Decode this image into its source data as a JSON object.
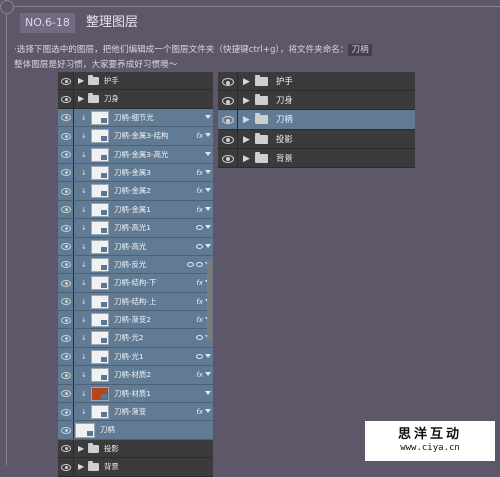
{
  "header": {
    "badge": "NO.6-18",
    "title": "整理图层",
    "instruction_line1_a": "·选择下图选中的图层，把他们编辑成一个图层文件夹（快捷键ctrl+g），将文件夹命名：",
    "instruction_line1_b": "刀柄",
    "instruction_line2": "整体图层是好习惯，大家要养成好习惯噢～"
  },
  "left_panel": {
    "rows": [
      {
        "label": "护手",
        "type": "group",
        "selected": false
      },
      {
        "label": "刀身",
        "type": "group",
        "selected": false
      },
      {
        "label": "刀柄-细节光",
        "type": "layer",
        "selected": true,
        "fx": ""
      },
      {
        "label": "刀柄-金属3-结构",
        "type": "layer",
        "selected": true,
        "fx": "fx"
      },
      {
        "label": "刀柄-金属3-高光",
        "type": "layer",
        "selected": true,
        "fx": ""
      },
      {
        "label": "刀柄-金属3",
        "type": "layer",
        "selected": true,
        "fx": "fx"
      },
      {
        "label": "刀柄-金属2",
        "type": "layer",
        "selected": true,
        "fx": "fx"
      },
      {
        "label": "刀柄-金属1",
        "type": "layer",
        "selected": true,
        "fx": "fx"
      },
      {
        "label": "刀柄-高光1",
        "type": "layer",
        "selected": true,
        "fx": "mark"
      },
      {
        "label": "刀柄-高光",
        "type": "layer",
        "selected": true,
        "fx": "mark"
      },
      {
        "label": "刀柄-反光",
        "type": "layer",
        "selected": true,
        "fx": "mark2"
      },
      {
        "label": "刀柄-结构-下",
        "type": "layer",
        "selected": true,
        "fx": "fx"
      },
      {
        "label": "刀柄-结构-上",
        "type": "layer",
        "selected": true,
        "fx": "fx"
      },
      {
        "label": "刀柄-渐变2",
        "type": "layer",
        "selected": true,
        "fx": "fx"
      },
      {
        "label": "刀柄-光2",
        "type": "layer",
        "selected": true,
        "fx": "mark"
      },
      {
        "label": "刀柄-光1",
        "type": "layer",
        "selected": true,
        "fx": "mark"
      },
      {
        "label": "刀柄-材质2",
        "type": "layer",
        "selected": true,
        "fx": "fx"
      },
      {
        "label": "刀柄-材质1",
        "type": "layer",
        "selected": true,
        "fx": "",
        "thumb": "red"
      },
      {
        "label": "刀柄-渐变",
        "type": "layer",
        "selected": true,
        "fx": "fx"
      },
      {
        "label": "刀柄",
        "type": "base",
        "selected": true,
        "fx": ""
      },
      {
        "label": "投影",
        "type": "group",
        "selected": false
      },
      {
        "label": "背景",
        "type": "group",
        "selected": false
      }
    ]
  },
  "right_panel": {
    "rows": [
      {
        "label": "护手",
        "selected": false
      },
      {
        "label": "刀身",
        "selected": false
      },
      {
        "label": "刀柄",
        "selected": true
      },
      {
        "label": "投影",
        "selected": false
      },
      {
        "label": "背景",
        "selected": false
      }
    ]
  },
  "watermark": {
    "title": "思洋互动",
    "url": "www.ciya.cn"
  },
  "colors": {
    "background": "#5e5769",
    "panel": "#3b3b3b",
    "selection": "#627b94"
  }
}
